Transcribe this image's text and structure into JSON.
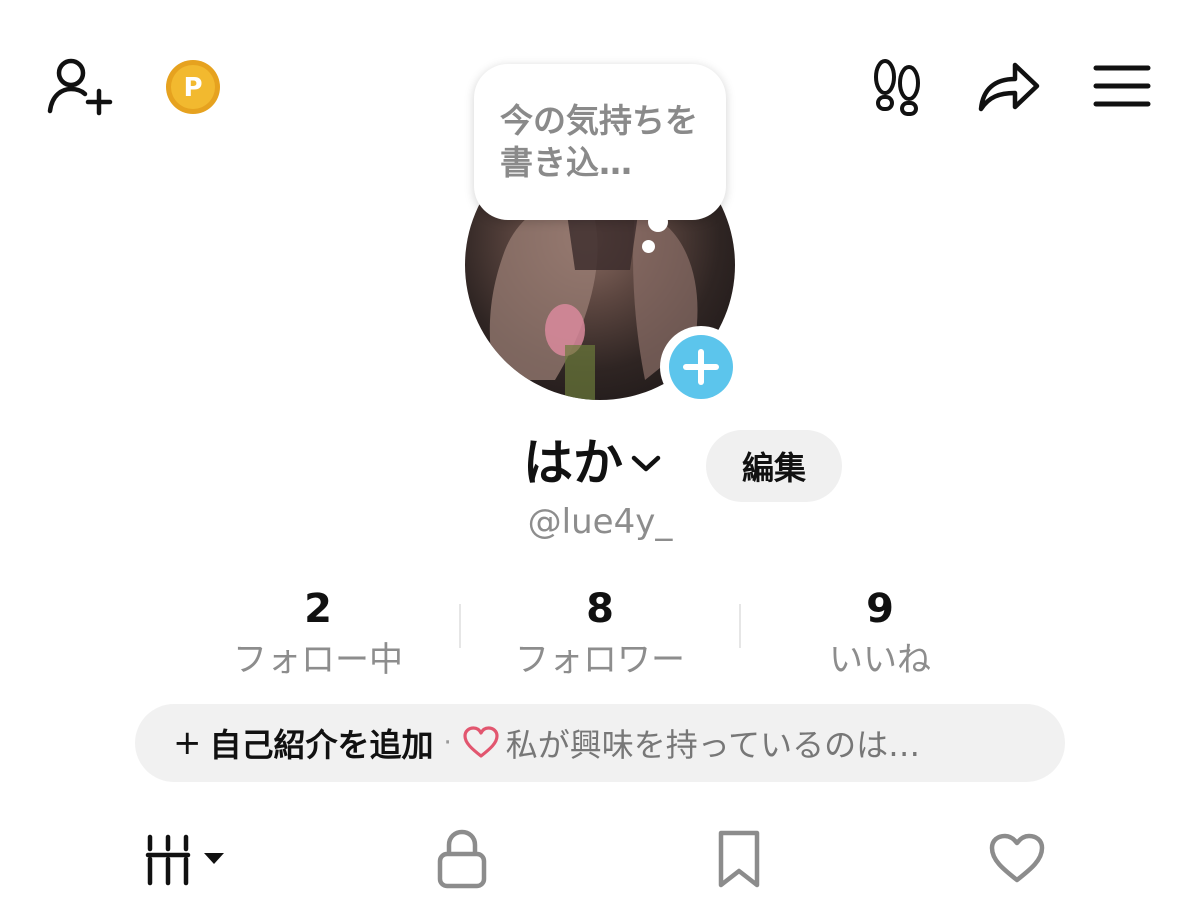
{
  "thought_bubble": {
    "text": "今の気持ちを書き込…"
  },
  "profile": {
    "display_name": "はか",
    "username": "@lue4y_",
    "edit_label": "編集"
  },
  "stats": [
    {
      "value": "2",
      "label": "フォロー中"
    },
    {
      "value": "8",
      "label": "フォロワー"
    },
    {
      "value": "9",
      "label": "いいね"
    }
  ],
  "bio": {
    "plus": "+",
    "add_label": "自己紹介を追加",
    "separator": "·",
    "hint": "私が興味を持っているのは…"
  },
  "coin": {
    "letter": "P"
  },
  "icons": {
    "top_left": [
      "add-friend-icon",
      "coin-icon"
    ],
    "top_right": [
      "footprints-icon",
      "share-icon",
      "menu-icon"
    ],
    "tabs": [
      "grid-sort-icon",
      "lock-icon",
      "bookmark-icon",
      "heart-icon"
    ]
  },
  "colors": {
    "accent_blue": "#5cc5ec",
    "heart_pink": "#e2566f",
    "coin_gold": "#f2b92f",
    "muted_text": "#8d8d8d"
  }
}
